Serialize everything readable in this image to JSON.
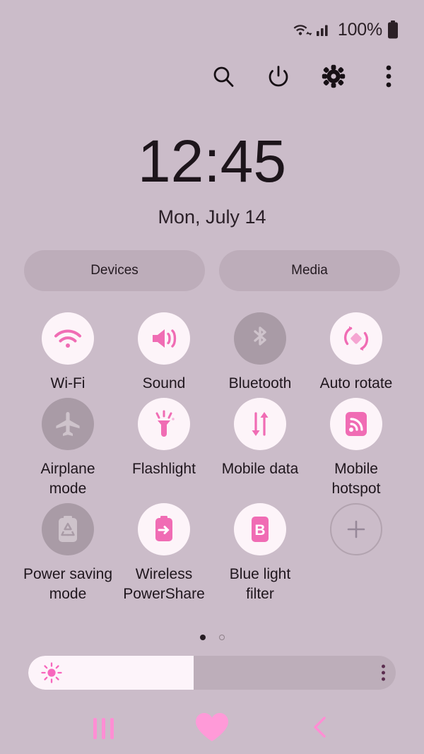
{
  "statusbar": {
    "wifi_icon": "wifi-data-icon",
    "signal_icon": "cellular-signal-icon",
    "battery_percent": "100%",
    "battery_icon": "battery-full-icon"
  },
  "header": {
    "buttons": [
      {
        "name": "search-icon",
        "label": "Search"
      },
      {
        "name": "power-icon",
        "label": "Power"
      },
      {
        "name": "settings-gear-icon",
        "label": "Settings"
      },
      {
        "name": "more-options-icon",
        "label": "More options"
      }
    ]
  },
  "clock": {
    "time": "12:45",
    "date": "Mon, July 14"
  },
  "pills": {
    "devices": "Devices",
    "media": "Media"
  },
  "quick_settings": {
    "tiles": [
      {
        "label": "Wi-Fi",
        "icon": "wifi-icon",
        "state": "on"
      },
      {
        "label": "Sound",
        "icon": "sound-icon",
        "state": "on"
      },
      {
        "label": "Bluetooth",
        "icon": "bluetooth-icon",
        "state": "off"
      },
      {
        "label": "Auto rotate",
        "icon": "auto-rotate-icon",
        "state": "on"
      },
      {
        "label": "Airplane mode",
        "icon": "airplane-icon",
        "state": "off"
      },
      {
        "label": "Flashlight",
        "icon": "flashlight-icon",
        "state": "on"
      },
      {
        "label": "Mobile data",
        "icon": "mobile-data-icon",
        "state": "on"
      },
      {
        "label": "Mobile hotspot",
        "icon": "mobile-hotspot-icon",
        "state": "on"
      },
      {
        "label": "Power saving mode",
        "icon": "power-saving-icon",
        "state": "off"
      },
      {
        "label": "Wireless PowerShare",
        "icon": "powershare-icon",
        "state": "on"
      },
      {
        "label": "Blue light filter",
        "icon": "blue-light-icon",
        "state": "on"
      },
      {
        "label": "",
        "icon": "plus-icon",
        "state": "add"
      }
    ]
  },
  "pagination": {
    "total_pages": 2,
    "current_page": 1
  },
  "brightness": {
    "value_percent": 45,
    "sun_icon": "brightness-sun-icon",
    "menu_icon": "brightness-options-icon"
  },
  "navbar": {
    "recents": "recents-button",
    "home": "home-heart-button",
    "back": "back-button"
  },
  "colors": {
    "background": "#cbbcc9",
    "accent_pink": "#f06cb4",
    "tile_on_bg": "#fdf4f9",
    "tile_off_bg": "#a99ba6",
    "pill_bg": "#bdadba",
    "nav_pink": "#ff8ed4"
  }
}
